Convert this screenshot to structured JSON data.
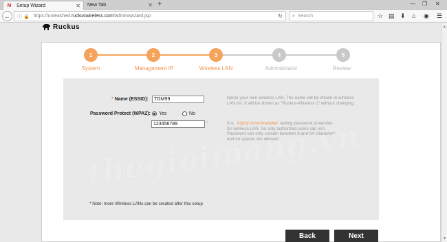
{
  "browser": {
    "tabs": [
      {
        "title": "Setup Wizard",
        "favicon": "M"
      },
      {
        "title": "New Tab"
      }
    ],
    "new_tab_label": "+",
    "window_controls": [
      "—",
      "❐",
      "✕"
    ],
    "url_prefix": "https://unleashed.",
    "url_host": "ruckuswireless.com",
    "url_path": "/admin/wizard.jsp",
    "search_placeholder": "Search"
  },
  "logo": {
    "text": "Ruckus"
  },
  "steps": [
    {
      "number": "1",
      "label": "System",
      "state": "done"
    },
    {
      "number": "2",
      "label": "Management IP",
      "state": "done"
    },
    {
      "number": "3",
      "label": "Wireless LAN",
      "state": "done"
    },
    {
      "number": "4",
      "label": "Administrator",
      "state": "todo"
    },
    {
      "number": "5",
      "label": "Review",
      "state": "todo"
    }
  ],
  "form": {
    "name_required_mark": "*",
    "name_label": "Name (ESSID):",
    "name_value": "TGM99",
    "name_help": "Name your own wireless LAN. The name will be shown in wireless LAN list. It will be shown as \"Ruckus-Wireless 1\" without changing.",
    "password_label": "Password Protect (WPA2):",
    "radio_yes": "Yes",
    "radio_no": "No",
    "password_protect": "Yes",
    "password_value": "123456789",
    "password_required_mark": "*",
    "password_help_prefix": "It is",
    "password_help_highlight": "highly recommended",
    "password_help_suffix": "setting password protection for wireless LAN. So only authorized users can join. Password can only contain between 8 and 64 characters and no spaces are allowed.",
    "note": "* Note: more Wireless LANs can be created after this setup"
  },
  "watermark": "thegioimang.vn",
  "buttons": {
    "back": "Back",
    "next": "Next"
  },
  "colors": {
    "accent": "#f5a25a",
    "inactive": "#c9c9c9",
    "button": "#333333"
  }
}
